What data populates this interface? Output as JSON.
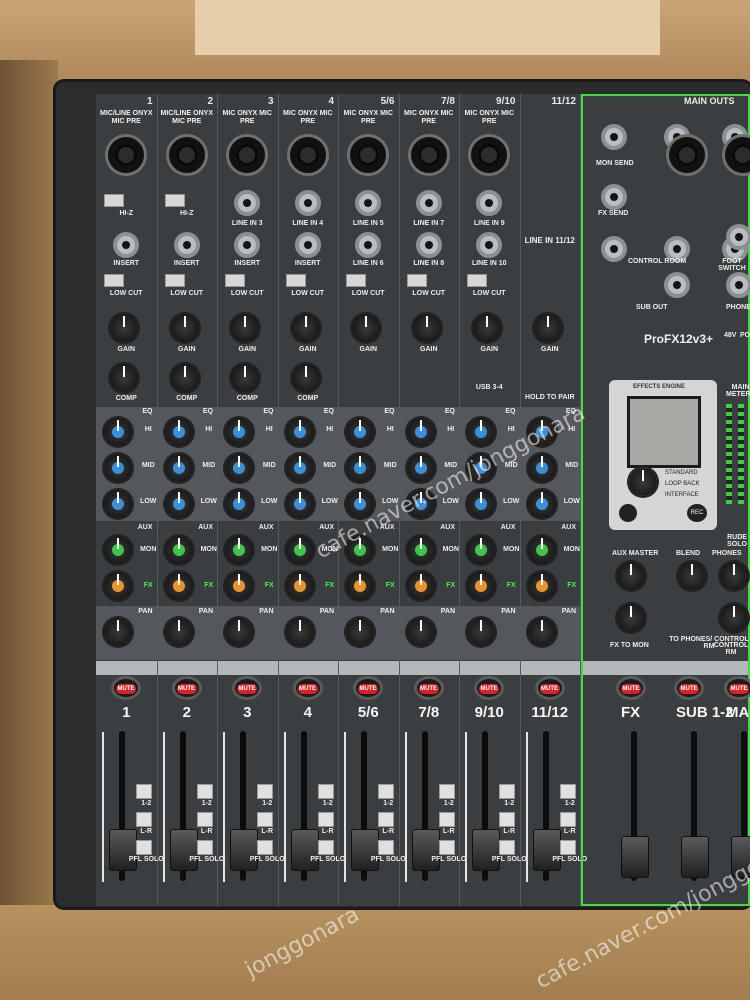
{
  "watermark": "cafe.naver.com/jonggonara",
  "watermark2": "jonggonara",
  "channels": [
    {
      "num": "1",
      "title": "MIC/LINE ONYX MIC PRE",
      "hiz": "HI-Z",
      "insert": "INSERT",
      "name": "1"
    },
    {
      "num": "2",
      "title": "MIC/LINE ONYX MIC PRE",
      "hiz": "HI-Z",
      "insert": "INSERT",
      "name": "2"
    },
    {
      "num": "3",
      "title": "MIC ONYX MIC PRE",
      "line": "LINE IN 3",
      "insert": "INSERT",
      "name": "3"
    },
    {
      "num": "4",
      "title": "MIC ONYX MIC PRE",
      "line": "LINE IN 4",
      "insert": "INSERT",
      "name": "4"
    },
    {
      "num": "5/6",
      "title": "MIC ONYX MIC PRE",
      "line": "LINE IN 5",
      "line2": "LINE IN 6",
      "name": "5/6"
    },
    {
      "num": "7/8",
      "title": "MIC ONYX MIC PRE",
      "line": "LINE IN 7",
      "line2": "LINE IN 8",
      "name": "7/8"
    },
    {
      "num": "9/10",
      "title": "MIC ONYX MIC PRE",
      "line": "LINE IN 9",
      "line2": "LINE IN 10",
      "name": "9/10"
    },
    {
      "num": "11/12",
      "title": "",
      "line": "LINE IN 11/12",
      "name": "11/12"
    }
  ],
  "labels": {
    "low_cut": "LOW CUT",
    "gain": "GAIN",
    "comp": "COMP",
    "eq": "EQ",
    "hi": "HI",
    "mid": "MID",
    "low": "LOW",
    "aux": "AUX",
    "mon": "MON",
    "fx": "FX",
    "pan": "PAN",
    "mute": "MUTE",
    "pfl_solo": "PFL SOLO",
    "bus_12": "1-2",
    "bus_lr": "L-R",
    "hold_to_pair": "HOLD TO PAIR",
    "usb": "USB 3-4"
  },
  "main_section": {
    "main_outs": "MAIN OUTS",
    "mon_send": "MON SEND",
    "fx_send": "FX SEND",
    "control_room": "CONTROL ROOM",
    "sub_out": "SUB OUT",
    "foot_switch": "FOOT SWITCH",
    "phones": "PHONES",
    "brand": "ProFX12v3+",
    "power_48v": "48V",
    "power": "POWER",
    "effects_engine": "EFFECTS ENGINE",
    "standard": "STANDARD",
    "loop_back": "LOOP BACK",
    "interface": "INTERFACE",
    "rec": "REC",
    "main_meters": "MAIN METERS",
    "rude_solo": "RUDE SOLO",
    "aux_master": "AUX MASTER",
    "blend": "BLEND",
    "to_phones": "TO PHONES/ CONTROL RM",
    "control_rm": "CONTROL RM",
    "fx_to_mon": "FX TO MON",
    "fx_label": "FX",
    "sub_label": "SUB 1-2",
    "main_label": "MAIN"
  },
  "knob_colors": {
    "eq": "#3b8fd6",
    "aux_mon": "#3ec64a",
    "aux_fx": "#e8942a"
  }
}
